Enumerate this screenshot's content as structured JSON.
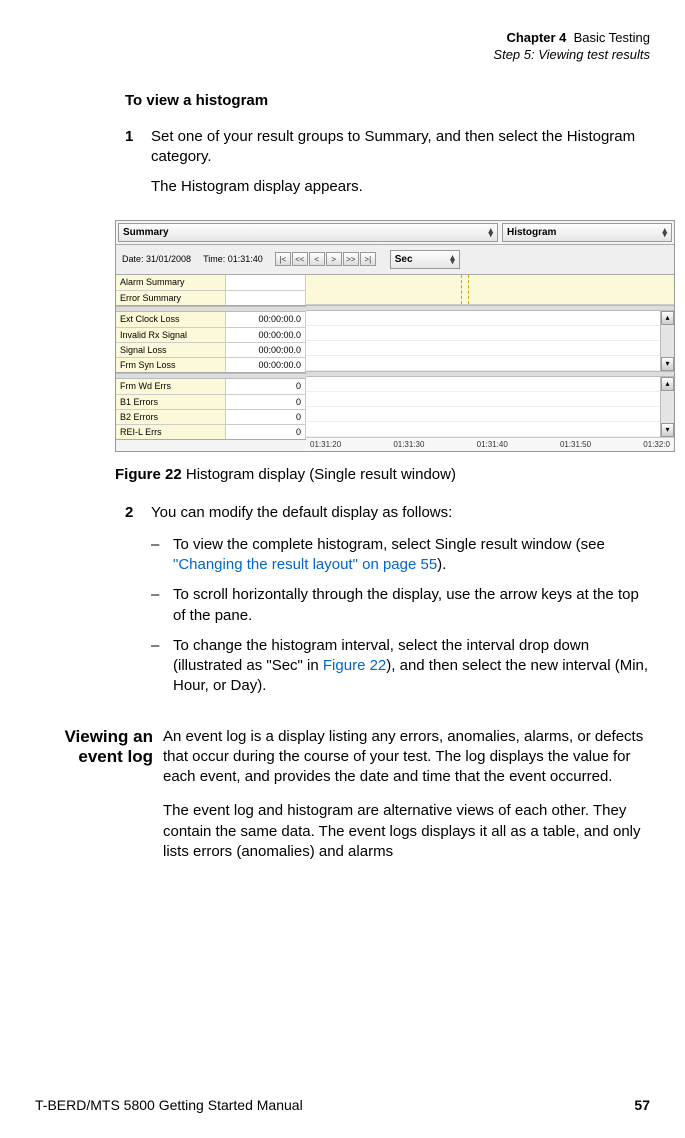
{
  "header": {
    "chapter_label": "Chapter 4",
    "chapter_title": "Basic Testing",
    "step_title": "Step 5: Viewing test results"
  },
  "content": {
    "subhead": "To view a histogram",
    "step1_num": "1",
    "step1_para1": "Set one of your result groups to Summary, and then select the Histogram category.",
    "step1_para2": "The Histogram display appears.",
    "step2_num": "2",
    "step2_text": "You can modify the default display as follows:",
    "bullet1_pre": "To view the complete histogram, select Single result window (see ",
    "bullet1_link": "\"Changing the result layout\" on page 55",
    "bullet1_post": ").",
    "bullet2": "To scroll horizontally through the display, use the arrow keys at the top of the pane.",
    "bullet3_pre": "To change the histogram interval, select the interval drop down (illustrated as \"Sec\" in ",
    "bullet3_link": "Figure 22",
    "bullet3_post": "), and then select the new interval (Min, Hour, or Day)."
  },
  "figure": {
    "caption_bold": "Figure 22",
    "caption_text": "Histogram display (Single result window)",
    "dd_summary": "Summary",
    "dd_histogram": "Histogram",
    "dd_sec": "Sec",
    "date_label": "Date: 31/01/2008",
    "time_label": "Time: 01:31:40",
    "nav": [
      "|<",
      "<<",
      "<",
      ">",
      ">>",
      ">|"
    ],
    "rows_a": [
      {
        "label": "Alarm Summary",
        "val": ""
      },
      {
        "label": "Error Summary",
        "val": ""
      }
    ],
    "rows_b": [
      {
        "label": "Ext Clock Loss",
        "val": "00:00:00.0"
      },
      {
        "label": "Invalid Rx Signal",
        "val": "00:00:00.0"
      },
      {
        "label": "Signal Loss",
        "val": "00:00:00.0"
      },
      {
        "label": "Frm Syn Loss",
        "val": "00:00:00.0"
      }
    ],
    "rows_c": [
      {
        "label": "Frm Wd Errs",
        "val": "0"
      },
      {
        "label": "B1 Errors",
        "val": "0"
      },
      {
        "label": "B2 Errors",
        "val": "0"
      },
      {
        "label": "REI-L Errs",
        "val": "0"
      }
    ],
    "axis": [
      "01:31:20",
      "01:31:30",
      "01:31:40",
      "01:31:50",
      "01:32:0"
    ]
  },
  "section": {
    "head_line1": "Viewing an",
    "head_line2": "event log",
    "para1": "An event log is a display listing any errors, anomalies, alarms, or defects that occur during the course of your test. The log displays the value for each event, and provides the date and time that the event occurred.",
    "para2": "The event log and histogram are alternative views of each other. They contain the same data. The event logs displays it all as a table, and only lists errors (anomalies) and alarms"
  },
  "footer": {
    "title": "T-BERD/MTS 5800 Getting Started Manual",
    "page": "57"
  }
}
